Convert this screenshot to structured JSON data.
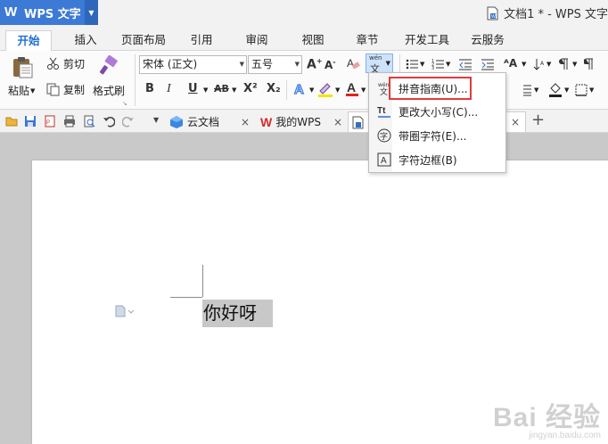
{
  "app": {
    "name": "WPS 文字",
    "window_title": "文档1 * - WPS 文字"
  },
  "tabs": [
    "开始",
    "插入",
    "页面布局",
    "引用",
    "审阅",
    "视图",
    "章节",
    "开发工具",
    "云服务"
  ],
  "ribbon": {
    "paste_label": "粘贴",
    "cut_label": "剪切",
    "copy_label": "复制",
    "format_painter_label": "格式刷",
    "font_name": "宋体 (正文)",
    "font_size": "五号",
    "bold": "B",
    "italic": "I",
    "underline": "U",
    "strikethrough": "AB",
    "superscript": "X²",
    "subscript": "X₂",
    "pinyin_top": "wén",
    "pinyin_char": "文"
  },
  "doc_tabs": [
    {
      "label": "云文档"
    },
    {
      "label": "我的WPS"
    }
  ],
  "document": {
    "selected_text": "你好呀"
  },
  "dropdown": {
    "items": [
      {
        "label": "拼音指南(U)...",
        "icon": "pinyin-icon"
      },
      {
        "label": "更改大小写(C)...",
        "icon": "change-case-icon"
      },
      {
        "label": "带圈字符(E)...",
        "icon": "circled-char-icon"
      },
      {
        "label": "字符边框(B)",
        "icon": "char-border-icon"
      }
    ],
    "highlight_color": "#e03b3b"
  },
  "watermark": {
    "line1": "Bai 经验",
    "line2": "jingyan.baidu.com"
  },
  "colors": {
    "accent": "#3c7ad6",
    "active_tab_text": "#1f6fd1"
  }
}
